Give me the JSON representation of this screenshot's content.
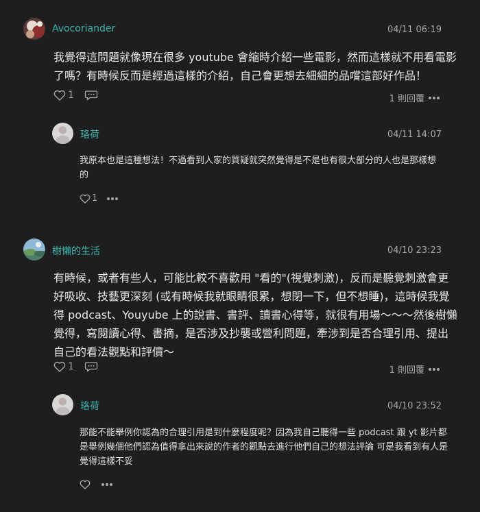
{
  "comments": [
    {
      "author": "Avocoriander",
      "time": "04/11 06:19",
      "text": "我覺得這問題就像現在很多 youtube 會縮時介紹一些電影，然而這樣就不用看電影了嗎？有時候反而是經過這樣的介紹，自己會更想去細細的品嚐這部好作品！",
      "likes": "1",
      "reply_count_label": "1 則回覆",
      "reply": {
        "author": "珞荷",
        "time": "04/11 14:07",
        "text": "我原本也是這種想法！不過看到人家的質疑就突然覺得是不是也有很大部分的人也是那樣想的",
        "likes": "1"
      }
    },
    {
      "author": "樹懶的生活",
      "time": "04/10 23:23",
      "text": "有時候，或者有些人，可能比較不喜歡用 \"看的\"(視覺刺激)，反而是聽覺刺激會更好吸收、技藝更深刻 (或有時候我就眼睛很累，想閉一下，但不想睡)，這時候我覺得 podcast、Youyube 上的說書、書評、讀書心得等，就很有用場～～～然後樹懶覺得，寫閱讀心得、書摘，是否涉及抄襲或營利問題，牽涉到是否合理引用、提出自己的看法觀點和評價～",
      "likes": "1",
      "reply_count_label": "1 則回覆",
      "reply": {
        "author": "珞荷",
        "time": "04/10 23:52",
        "text": "那能不能舉例你認為的合理引用是到什麼程度呢？因為我自己聽得一些 podcast 跟 yt 影片都是舉例幾個他們認為值得拿出來說的作者的觀點去進行他們自己的想法評論 可是我看到有人是覺得這樣不妥",
        "likes": ""
      }
    }
  ],
  "icons": {
    "like": "heart-outline-icon",
    "comment": "speech-bubble-icon",
    "more": "more-dots-icon"
  },
  "colors": {
    "background": "#1e1e1e",
    "author_name": "#3fb5b0",
    "meta_text": "#a8a8a8",
    "body_text": "#e8e8e8"
  }
}
